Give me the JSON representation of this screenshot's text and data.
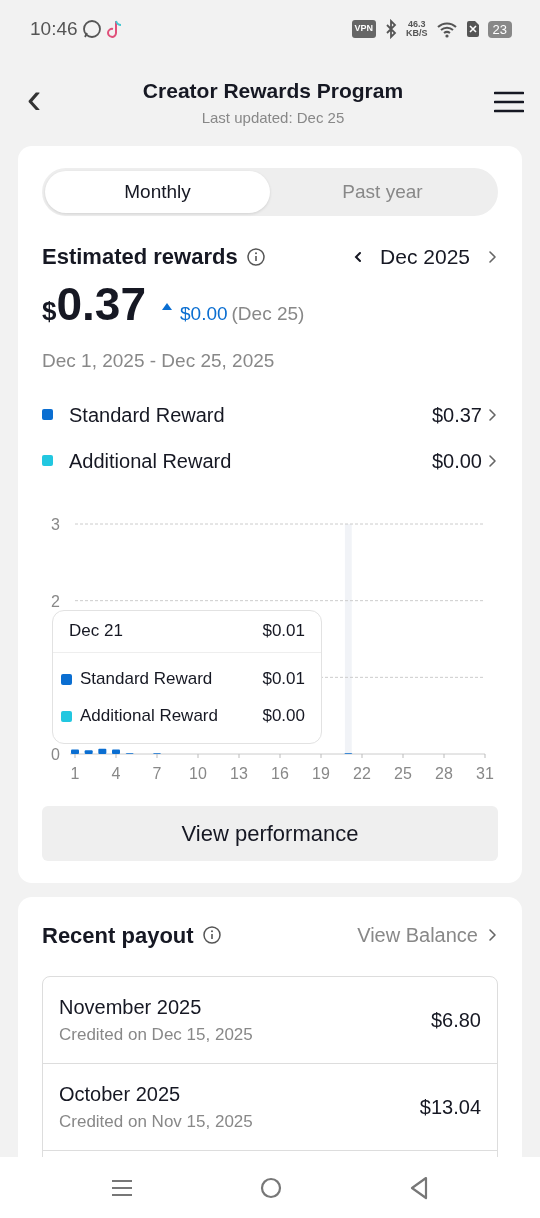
{
  "status_bar": {
    "time": "10:46",
    "vpn": "VPN",
    "speed_value": "46.3",
    "speed_unit": "KB/S",
    "battery": "23"
  },
  "header": {
    "back": "‹",
    "title": "Creator Rewards Program",
    "subtitle": "Last updated: Dec 25"
  },
  "tabs": [
    {
      "label": "Monthly",
      "selected": true
    },
    {
      "label": "Past year",
      "selected": false
    }
  ],
  "rewards": {
    "title": "Estimated rewards",
    "month": "Dec 2025",
    "currency": "$",
    "amount": "0.37",
    "change": "$0.00",
    "change_date": "(Dec 25)",
    "period": "Dec 1, 2025 - Dec 25, 2025",
    "items": [
      {
        "name": "Standard Reward",
        "value": "$0.37",
        "color": "#0a6ed1"
      },
      {
        "name": "Additional Reward",
        "value": "$0.00",
        "color": "#22c7e0"
      }
    ]
  },
  "chart": {
    "tooltip": {
      "date": "Dec 21",
      "total": "$0.01",
      "values": [
        "$0.01",
        "$0.00"
      ]
    },
    "chart_data": {
      "type": "bar",
      "xlim": [
        1,
        31
      ],
      "x": [
        1,
        2,
        3,
        4,
        5,
        6,
        7,
        8,
        9,
        10,
        11,
        12,
        13,
        14,
        15,
        16,
        17,
        18,
        19,
        20,
        21,
        22,
        23,
        24,
        25
      ],
      "series": [
        {
          "name": "Standard Reward",
          "color": "#0a6ed1",
          "values": [
            0.06,
            0.05,
            0.07,
            0.06,
            0.01,
            0,
            0.01,
            0,
            0,
            0,
            0,
            0,
            0,
            0,
            0,
            0,
            0,
            0,
            0,
            0,
            0.01,
            0,
            0,
            0,
            0
          ]
        },
        {
          "name": "Additional Reward",
          "color": "#22c7e0",
          "values": [
            0,
            0,
            0,
            0,
            0,
            0,
            0,
            0,
            0,
            0,
            0,
            0,
            0,
            0,
            0,
            0,
            0,
            0,
            0,
            0,
            0,
            0,
            0,
            0,
            0
          ]
        }
      ],
      "bands": [
        {
          "axis": "x",
          "from": 20.75,
          "to": 21.25
        }
      ],
      "ylim": [
        0,
        3
      ],
      "yticks": [
        0,
        2,
        3
      ],
      "xticks": [
        1,
        4,
        7,
        10,
        13,
        16,
        19,
        22,
        25,
        28,
        31
      ]
    }
  },
  "view_performance": "View performance",
  "payout": {
    "title": "Recent payout",
    "link": "View Balance",
    "rows": [
      {
        "month": "November 2025",
        "credited": "Credited on Dec 15, 2025",
        "amount": "$6.80"
      },
      {
        "month": "October 2025",
        "credited": "Credited on Nov 15, 2025",
        "amount": "$13.04"
      }
    ]
  }
}
